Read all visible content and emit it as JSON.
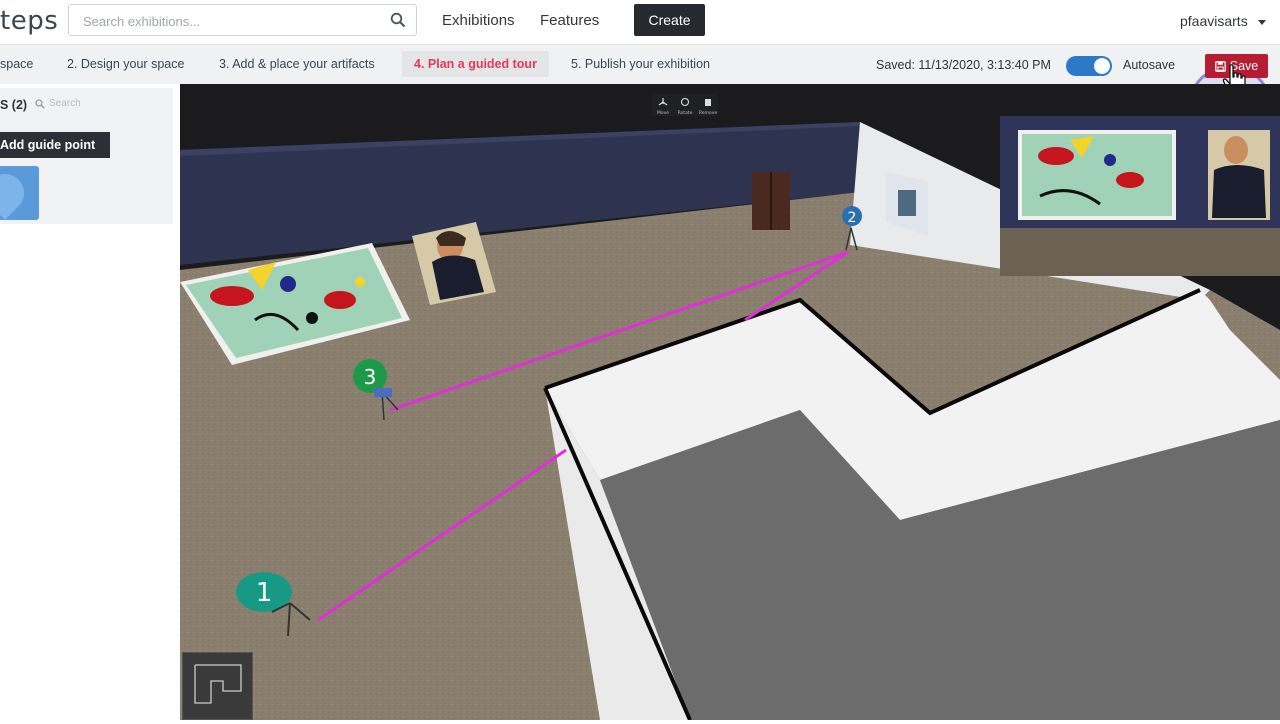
{
  "header": {
    "logo_text": "teps",
    "search_placeholder": "Search exhibitions...",
    "nav": [
      "Exhibitions",
      "Features"
    ],
    "create_label": "Create",
    "username": "pfaavisarts"
  },
  "steps": {
    "items": [
      {
        "label": "space",
        "active": false
      },
      {
        "label": "2. Design your space",
        "active": false
      },
      {
        "label": "3. Add & place your artifacts",
        "active": false
      },
      {
        "label": "4. Plan a guided tour",
        "active": true
      },
      {
        "label": "5. Publish your exhibition",
        "active": false
      }
    ],
    "saved_text": "Saved: 11/13/2020, 3:13:40 PM",
    "autosave_label": "Autosave",
    "autosave_on": true,
    "save_label": "Save"
  },
  "panel": {
    "title": "S (2)",
    "search_placeholder": "Search",
    "add_button": "Add guide point"
  },
  "viewport": {
    "toolbar": [
      "Move",
      "Rotate",
      "Remove"
    ],
    "guide_points": [
      "1",
      "2",
      "3"
    ],
    "path_color": "#e02ed8",
    "marker_colors": {
      "1": "#169a86",
      "2": "#2a6fae",
      "3": "#1c9a4a"
    }
  },
  "colors": {
    "accent_red": "#b81c33",
    "active_step": "#e23b56",
    "toggle_blue": "#2c79c9"
  }
}
